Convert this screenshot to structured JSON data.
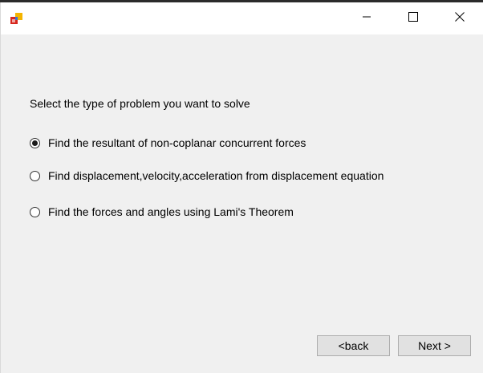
{
  "window": {
    "icon": "app-icon",
    "controls": {
      "minimize_icon": "minimize-icon",
      "maximize_icon": "maximize-icon",
      "close_icon": "close-icon"
    }
  },
  "form": {
    "prompt": "Select the type of problem you want to solve",
    "options": [
      {
        "label": "Find the resultant of non-coplanar concurrent forces",
        "checked": true
      },
      {
        "label": "Find displacement,velocity,acceleration from displacement equation",
        "checked": false
      },
      {
        "label": "Find the forces and angles using Lami's Theorem",
        "checked": false
      }
    ]
  },
  "buttons": {
    "back_label": "<back",
    "next_label": "Next >"
  },
  "colors": {
    "window_bg": "#f0f0f0",
    "titlebar_bg": "#ffffff",
    "button_bg": "#e1e1e1",
    "button_border": "#adadad"
  }
}
